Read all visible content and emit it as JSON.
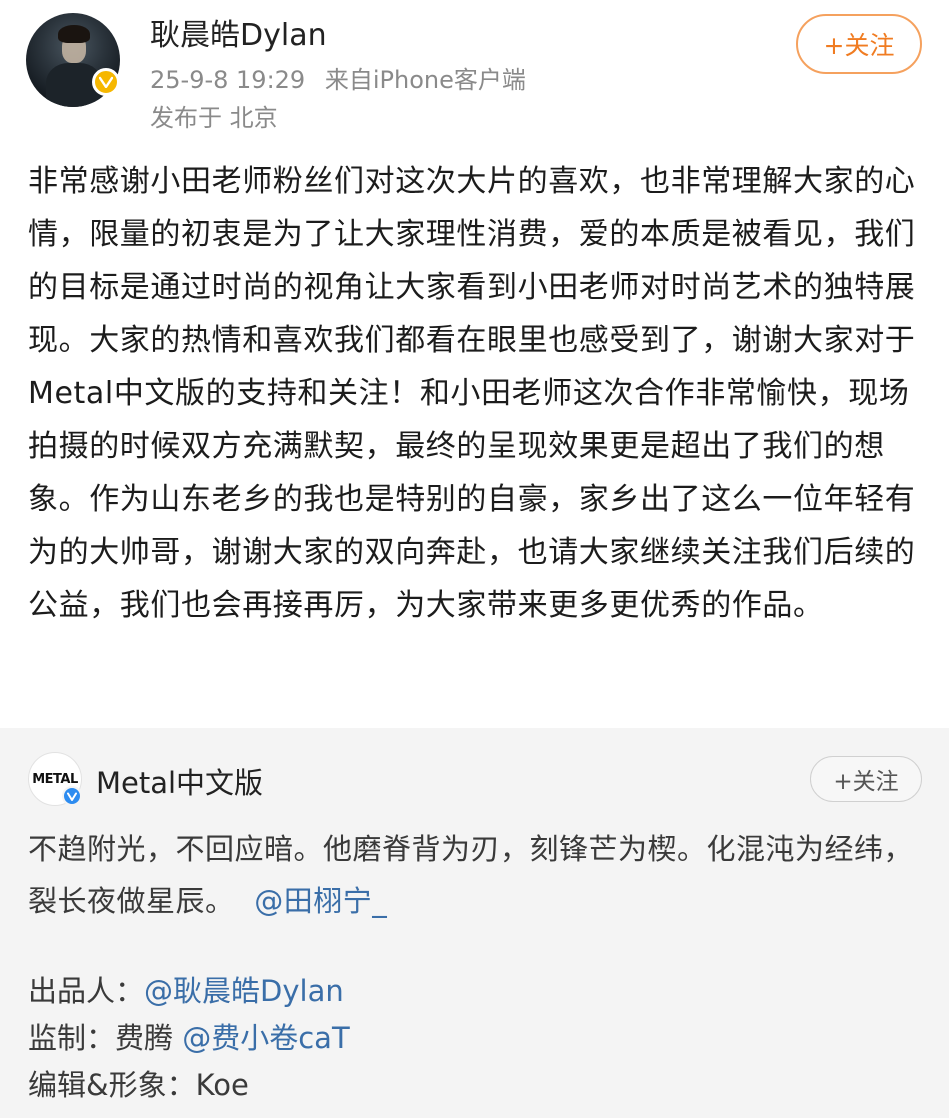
{
  "post": {
    "username": "耿晨皓Dylan",
    "timestamp": "25-9-8 19:29",
    "source_prefix": "来自",
    "source_device": "iPhone客户端",
    "location": "发布于 北京",
    "follow_label": "+关注",
    "verified_badge_color": "#f6b700",
    "body": "非常感谢小田老师粉丝们对这次大片的喜欢，也非常理解大家的心情，限量的初衷是为了让大家理性消费，爱的本质是被看见，我们的目标是通过时尚的视角让大家看到小田老师对时尚艺术的独特展现。大家的热情和喜欢我们都看在眼里也感受到了，谢谢大家对于Metal中文版的支持和关注！和小田老师这次合作非常愉快，现场拍摄的时候双方充满默契，最终的呈现效果更是超出了我们的想象。作为山东老乡的我也是特别的自豪，家乡出了这么一位年轻有为的大帅哥，谢谢大家的双向奔赴，也请大家继续关注我们后续的公益，我们也会再接再厉，为大家带来更多更优秀的作品。"
  },
  "repost": {
    "avatar_text": "METAL",
    "username": "Metal中文版",
    "follow_label": "+关注",
    "verified_badge_color": "#2d8cf0",
    "text": "不趋附光，不回应暗。他磨脊背为刃，刻锋芒为楔。化混沌为经纬，裂长夜做星辰。",
    "text_mention": "@田栩宁_",
    "credits": [
      {
        "label": "出品人：",
        "name": "",
        "mention": "@耿晨皓Dylan"
      },
      {
        "label": "监制：",
        "name": "费腾 ",
        "mention": "@费小卷caT"
      },
      {
        "label": "编辑&形象：",
        "name": "Koe",
        "mention": ""
      }
    ]
  },
  "colors": {
    "follow_orange": "#f07c22",
    "mention_blue": "#3a6ea8",
    "repost_bg": "#f4f4f4"
  }
}
